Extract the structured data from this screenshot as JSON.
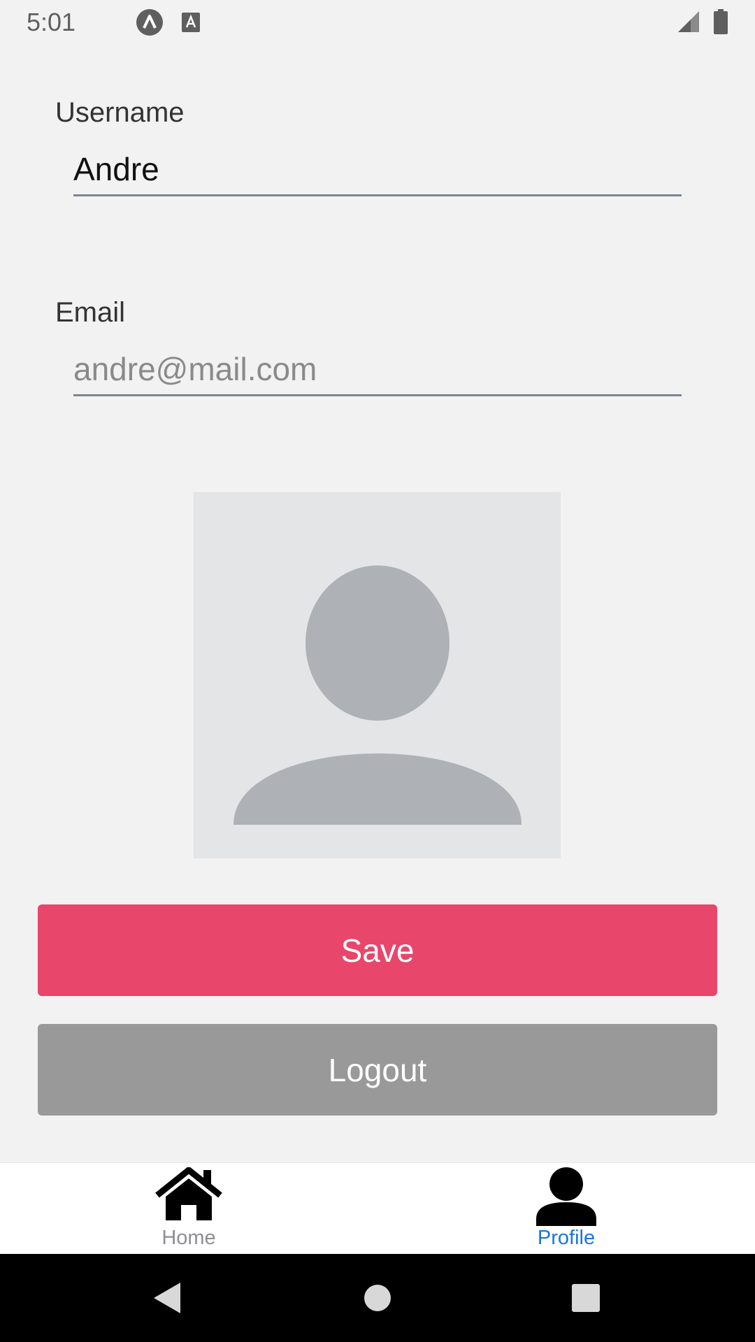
{
  "status_bar": {
    "time": "5:01",
    "icons": [
      "expo-icon",
      "keyboard-a-icon",
      "signal-icon",
      "battery-icon"
    ]
  },
  "form": {
    "username_label": "Username",
    "username_value": "Andre",
    "email_label": "Email",
    "email_placeholder": "andre@mail.com"
  },
  "avatar": {
    "icon": "person-placeholder-icon"
  },
  "buttons": {
    "save_label": "Save",
    "logout_label": "Logout"
  },
  "tab_bar": {
    "tabs": [
      {
        "label": "Home",
        "icon": "home-icon",
        "active": false
      },
      {
        "label": "Profile",
        "icon": "person-icon",
        "active": true
      }
    ]
  },
  "nav_bar": {
    "buttons": [
      "back-icon",
      "home-circle-icon",
      "recents-icon"
    ]
  },
  "colors": {
    "accent": "#e8466a",
    "secondary_button": "#999999",
    "active_tab": "#1976e0",
    "inactive_tab": "#8e8e93",
    "background": "#f2f2f2"
  }
}
